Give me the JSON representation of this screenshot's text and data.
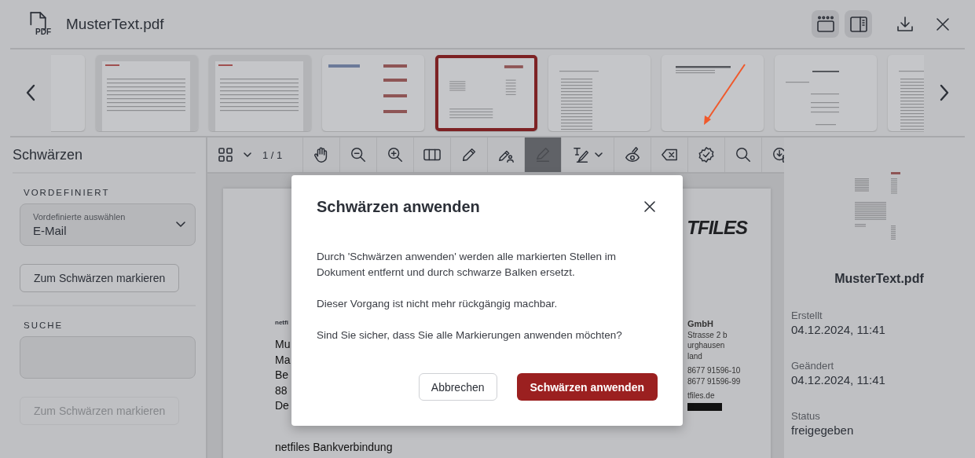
{
  "header": {
    "file_type": "PDF",
    "title": "MusterText.pdf",
    "buttons": [
      {
        "kind": "thumbnails-view",
        "on": true
      },
      {
        "kind": "sidebar-view",
        "on": true
      },
      {
        "kind": "download",
        "on": false
      },
      {
        "kind": "close",
        "on": false
      }
    ]
  },
  "thumbnails": [
    {
      "kind": "table",
      "selected": false
    },
    {
      "kind": "app",
      "selected": false
    },
    {
      "kind": "app",
      "selected": false
    },
    {
      "kind": "logos",
      "selected": false
    },
    {
      "kind": "letter",
      "selected": true
    },
    {
      "kind": "lines",
      "selected": false
    },
    {
      "kind": "heading",
      "selected": false
    },
    {
      "kind": "contract",
      "selected": false
    },
    {
      "kind": "lines",
      "selected": false
    }
  ],
  "sidebar": {
    "title": "Schwärzen",
    "sections": [
      {
        "kind": "select",
        "heading": "VORDEFINIERT",
        "select": {
          "label": "Vordefinierte auswählen",
          "value": "E-Mail"
        },
        "button": {
          "label": "Zum Schwärzen markieren",
          "disabled": false
        }
      },
      {
        "kind": "search",
        "heading": "SUCHE",
        "button": {
          "label": "Zum Schwärzen markieren",
          "disabled": true
        }
      }
    ]
  },
  "toolbar": {
    "page_indicator": "1 / 1",
    "tools": [
      {
        "kind": "hand",
        "selected": false,
        "dropdown": false
      },
      {
        "kind": "zoom-out",
        "selected": false,
        "dropdown": false
      },
      {
        "kind": "zoom-in",
        "selected": false,
        "dropdown": false
      },
      {
        "kind": "columns",
        "selected": false,
        "dropdown": false
      },
      {
        "kind": "pencil",
        "selected": false,
        "dropdown": false
      },
      {
        "kind": "pencil-person",
        "selected": false,
        "dropdown": false
      },
      {
        "kind": "highlighter",
        "selected": true,
        "dropdown": false
      },
      {
        "kind": "text-signature",
        "selected": false,
        "dropdown": true
      },
      {
        "kind": "eye-pen",
        "selected": false,
        "dropdown": false
      },
      {
        "kind": "backspace",
        "selected": false,
        "dropdown": false
      },
      {
        "kind": "badge-check",
        "selected": false,
        "dropdown": false
      },
      {
        "kind": "search",
        "selected": false,
        "dropdown": false
      },
      {
        "kind": "download-doc",
        "selected": false,
        "dropdown": false
      }
    ]
  },
  "document": {
    "logo": "TFILES",
    "sender": "netfi",
    "left_lines": [
      "Mu",
      "Ma",
      "Be",
      "88",
      "De"
    ],
    "right_lines": [
      {
        "text": "GmbH",
        "bold": true
      },
      {
        "text": "Strasse 2 b",
        "bold": false
      },
      {
        "text": "urghausen",
        "bold": false
      },
      {
        "text": "land",
        "bold": false
      },
      {
        "text": "8677 91596-10",
        "bold": false
      },
      {
        "text": "8677 91596-99",
        "bold": false
      },
      {
        "text": "tfiles.de",
        "bold": false
      }
    ],
    "footer": "netfiles Bankverbindung"
  },
  "details": {
    "file_name": "MusterText.pdf",
    "fields": [
      {
        "label": "Erstellt",
        "value": "04.12.2024, 11:41"
      },
      {
        "label": "Geändert",
        "value": "04.12.2024, 11:41"
      },
      {
        "label": "Status",
        "value": "freigegeben"
      }
    ]
  },
  "dialog": {
    "title": "Schwärzen anwenden",
    "paragraphs": [
      "Durch 'Schwärzen anwenden' werden alle markierten Stellen im Dokument entfernt und durch schwarze Balken ersetzt.",
      "Dieser Vorgang ist nicht mehr rückgängig machbar.",
      "Sind Sie sicher, dass Sie alle Markierungen anwenden möchten?"
    ],
    "cancel": "Abbrechen",
    "confirm": "Schwärzen anwenden"
  }
}
